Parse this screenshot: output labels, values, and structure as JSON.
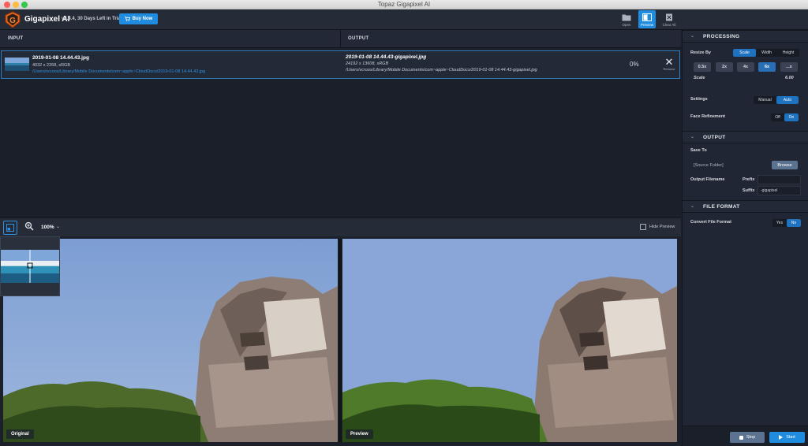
{
  "window": {
    "title": "Topaz Gigapixel AI"
  },
  "header": {
    "app_name": "Gigapixel AI",
    "version_trial": "v4.4.4, 30 Days Left in Trial",
    "buy_label": "Buy Now",
    "tools": [
      {
        "label": "Open",
        "icon": "folder-icon"
      },
      {
        "label": "Preview",
        "icon": "preview-icon"
      },
      {
        "label": "Clear All",
        "icon": "clear-all-icon"
      }
    ]
  },
  "table": {
    "input_header": "INPUT",
    "output_header": "OUTPUT",
    "row": {
      "input_name": "2019-01-08 14.44.43.jpg",
      "input_meta": "4032 x 2268, sRGB",
      "input_path": "/Users/vcroos/Library/Mobile Documents/com~apple~CloudDocs/2019-01-08 14.44.43.jpg",
      "output_name": "2019-01-08 14.44.43-gigapixel.jpg",
      "output_meta": "24192 x 13608, sRGB",
      "output_path": "/Users/vcroos/Library/Mobile Documents/com~apple~CloudDocs/2019-01-08 14.44.43-gigapixel.jpg",
      "progress": "0%",
      "remove_label": "Remove"
    }
  },
  "preview": {
    "zoom": "100%",
    "hide_preview": "Hide Preview",
    "original_label": "Original",
    "preview_label": "Preview"
  },
  "panel": {
    "processing": {
      "title": "PROCESSING",
      "resize_by_label": "Resize By",
      "resize_options": [
        "Scale",
        "Width",
        "Height"
      ],
      "resize_selected": "Scale",
      "scale_buttons": [
        "0.5x",
        "2x",
        "4x",
        "6x",
        "...x"
      ],
      "scale_selected": "6x",
      "scale_label": "Scale",
      "scale_value": "6.00",
      "settings_label": "Settings",
      "settings_options": [
        "Manual",
        "Auto"
      ],
      "settings_selected": "Auto",
      "face_label": "Face Refinement",
      "face_options": [
        "Off",
        "On"
      ],
      "face_selected": "On"
    },
    "output": {
      "title": "OUTPUT",
      "save_to_label": "Save To",
      "save_to_value": "[Source Folder]",
      "browse_label": "Browse",
      "filename_label": "Output Filename",
      "prefix_label": "Prefix",
      "prefix_value": "",
      "suffix_label": "Suffix",
      "suffix_value": "-gigapixel"
    },
    "file_format": {
      "title": "FILE FORMAT",
      "convert_label": "Convert File Format",
      "options": [
        "Yes",
        "No"
      ],
      "selected": "No"
    },
    "stop_label": "Stop",
    "start_label": "Start"
  },
  "colors": {
    "accent": "#1f8ce0",
    "panel": "#202633",
    "background": "#1b202b"
  }
}
